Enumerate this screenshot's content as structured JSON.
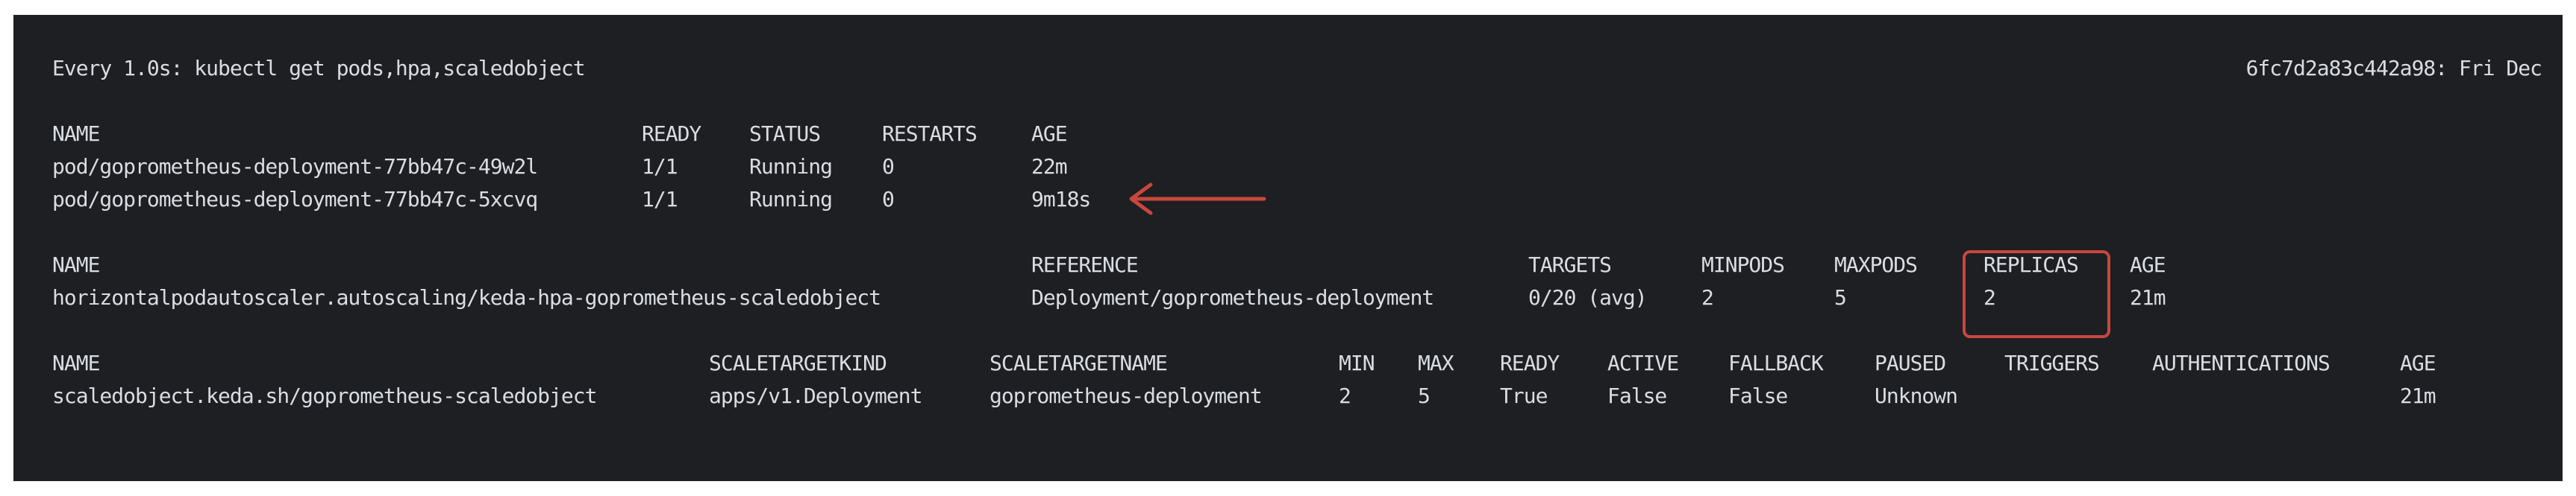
{
  "watch": {
    "command": "Every 1.0s: kubectl get pods,hpa,scaledobject",
    "host_time": "6fc7d2a83c442a98: Fri Dec"
  },
  "pods": {
    "headers": [
      "NAME",
      "READY",
      "STATUS",
      "RESTARTS",
      "AGE"
    ],
    "rows": [
      [
        "pod/goprometheus-deployment-77bb47c-49w2l",
        "1/1",
        "Running",
        "0",
        "22m"
      ],
      [
        "pod/goprometheus-deployment-77bb47c-5xcvq",
        "1/1",
        "Running",
        "0",
        "9m18s"
      ]
    ]
  },
  "hpa": {
    "headers": [
      "NAME",
      "REFERENCE",
      "TARGETS",
      "MINPODS",
      "MAXPODS",
      "REPLICAS",
      "AGE"
    ],
    "rows": [
      [
        "horizontalpodautoscaler.autoscaling/keda-hpa-goprometheus-scaledobject",
        "Deployment/goprometheus-deployment",
        "0/20 (avg)",
        "2",
        "5",
        "2",
        "21m"
      ]
    ]
  },
  "scaledobject": {
    "headers": [
      "NAME",
      "SCALETARGETKIND",
      "SCALETARGETNAME",
      "MIN",
      "MAX",
      "READY",
      "ACTIVE",
      "FALLBACK",
      "PAUSED",
      "TRIGGERS",
      "AUTHENTICATIONS",
      "AGE"
    ],
    "rows": [
      [
        "scaledobject.keda.sh/goprometheus-scaledobject",
        "apps/v1.Deployment",
        "goprometheus-deployment",
        "2",
        "5",
        "True",
        "False",
        "False",
        "Unknown",
        "",
        "",
        "21m"
      ]
    ]
  },
  "annotations": {
    "accent_color": "#c8473f",
    "arrow_icon": "left-arrow-icon",
    "highlight": "replicas-highlight-box"
  }
}
